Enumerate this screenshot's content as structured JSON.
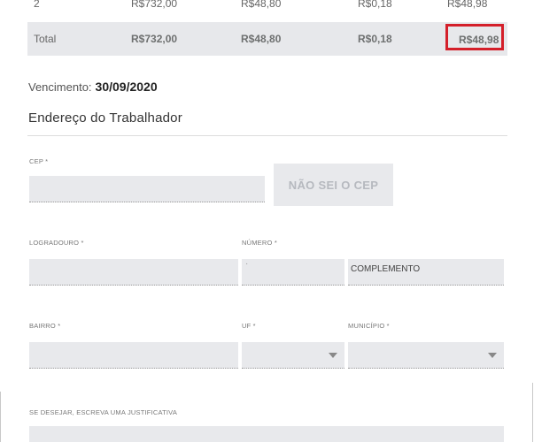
{
  "table": {
    "row_2": {
      "index": "2",
      "value1": "R$732,00",
      "value2": "R$48,80",
      "value3": "R$0,18",
      "value4": "R$48,98"
    },
    "total": {
      "label": "Total",
      "value1": "R$732,00",
      "value2": "R$48,80",
      "value3": "R$0,18",
      "value4": "R$48,98"
    }
  },
  "vencimento": {
    "label": "Vencimento:",
    "date": "30/09/2020"
  },
  "section": {
    "title": "Endereço do Trabalhador"
  },
  "form": {
    "cep_label": "CEP *",
    "cep_button": "NÃO SEI O CEP",
    "logradouro_label": "LOGRADOURO *",
    "numero_label": "NÚMERO *",
    "numero_hint": "·",
    "complemento_placeholder": "COMPLEMENTO",
    "bairro_label": "BAIRRO *",
    "uf_label": "UF *",
    "municipio_label": "MUNICÍPIO *",
    "justificativa_label": "SE DESEJAR, ESCREVA UMA JUSTIFICATIVA"
  },
  "colors": {
    "highlight": "#d41f2a",
    "field_bg": "#e8e9ec",
    "total_bg": "#e7e8eb"
  }
}
